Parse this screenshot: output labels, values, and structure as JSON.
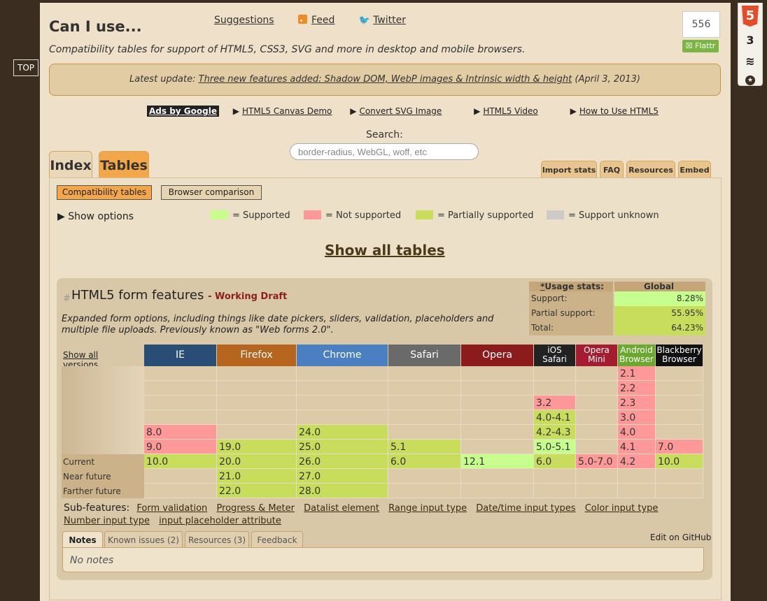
{
  "top_button": "TOP",
  "header": {
    "title": "Can I use...",
    "tagline": "Compatibility tables for support of HTML5, CSS3, SVG and more in desktop and mobile browsers.",
    "links": {
      "suggestions": "Suggestions",
      "feed": "Feed",
      "twitter": "Twitter"
    },
    "flattr_count": "556",
    "flattr_label": "Flattr"
  },
  "update": {
    "prefix": "Latest update:",
    "link": "Three new features added: Shadow DOM, WebP images & Intrinsic width & height",
    "date": "(April 3, 2013)"
  },
  "ads": {
    "label": "Ads by Google",
    "links": [
      "HTML5 Canvas Demo",
      "Convert SVG Image",
      "HTML5 Video",
      "How to Use HTML5"
    ]
  },
  "search": {
    "label": "Search:",
    "placeholder": "border-radius, WebGL, woff, etc"
  },
  "tabs": {
    "main": [
      "Index",
      "Tables"
    ],
    "active": "Tables",
    "small": [
      "Import stats",
      "FAQ",
      "Resources",
      "Embed"
    ]
  },
  "panel": {
    "modes": [
      "Compatibility tables",
      "Browser comparison"
    ],
    "show_options": "Show options",
    "legend": [
      {
        "label": "= Supported",
        "color": "#c6ff8e"
      },
      {
        "label": "= Not supported",
        "color": "#ff9999"
      },
      {
        "label": "= Partially supported",
        "color": "#c8dd5c"
      },
      {
        "label": "= Support unknown",
        "color": "#cfcaca"
      }
    ],
    "show_all_tables": "Show all tables"
  },
  "feature": {
    "hash": "#",
    "title": "HTML5 form features",
    "status_sep": "-",
    "status": "Working Draft",
    "description": "Expanded form options, including things like date pickers, sliders, validation, placeholders and multiple file uploads. Previously known as \"Web forms 2.0\".",
    "usage": {
      "header_label": "Usage stats:",
      "header_star": "*",
      "header_value": "Global",
      "rows": [
        {
          "label": "Support:",
          "value": "8.28%",
          "color": "#c6ff8e"
        },
        {
          "label": "Partial support:",
          "value": "55.95%",
          "color": "#c8dd5c"
        },
        {
          "label": "Total:",
          "value": "64.23%",
          "color": "#c8dd5c"
        }
      ]
    },
    "show_all_versions": "Show all versions",
    "row_labels": [
      "",
      "",
      "",
      "",
      "",
      "",
      "Current",
      "Near future",
      "Farther future"
    ],
    "browsers": [
      {
        "name": "IE",
        "color": "#294d75",
        "cells": [
          null,
          null,
          null,
          null,
          [
            "8.0",
            "n"
          ],
          [
            "9.0",
            "n"
          ],
          [
            "10.0",
            "p"
          ],
          null,
          null
        ]
      },
      {
        "name": "Firefox",
        "color": "#b5651d",
        "cells": [
          null,
          null,
          null,
          null,
          null,
          [
            "19.0",
            "p"
          ],
          [
            "20.0",
            "p"
          ],
          [
            "21.0",
            "p"
          ],
          [
            "22.0",
            "p"
          ]
        ]
      },
      {
        "name": "Chrome",
        "color": "#4a7fc1",
        "cells": [
          null,
          null,
          null,
          null,
          [
            "24.0",
            "p"
          ],
          [
            "25.0",
            "p"
          ],
          [
            "26.0",
            "p"
          ],
          [
            "27.0",
            "p"
          ],
          [
            "28.0",
            "p"
          ]
        ]
      },
      {
        "name": "Safari",
        "color": "#6a6a6a",
        "cells": [
          null,
          null,
          null,
          null,
          null,
          [
            "5.1",
            "p"
          ],
          [
            "6.0",
            "p"
          ],
          null,
          null
        ]
      },
      {
        "name": "Opera",
        "color": "#8c1c1c",
        "cells": [
          null,
          null,
          null,
          null,
          null,
          null,
          [
            "12.1",
            "y"
          ],
          null,
          null
        ]
      },
      {
        "name": "iOS Safari",
        "color": "#222222",
        "cells": [
          null,
          null,
          [
            "3.2",
            "n"
          ],
          [
            "4.0-4.1",
            "p"
          ],
          [
            "4.2-4.3",
            "p"
          ],
          [
            "5.0-5.1",
            "y"
          ],
          [
            "6.0",
            "p"
          ],
          null,
          null
        ]
      },
      {
        "name": "Opera Mini",
        "color": "#a51c30",
        "cells": [
          null,
          null,
          null,
          null,
          null,
          null,
          [
            "5.0-7.0",
            "n"
          ],
          null,
          null
        ]
      },
      {
        "name": "Android Browser",
        "color": "#6aa82e",
        "cells": [
          [
            "2.1",
            "n"
          ],
          [
            "2.2",
            "n"
          ],
          [
            "2.3",
            "n"
          ],
          [
            "3.0",
            "n"
          ],
          [
            "4.0",
            "n"
          ],
          [
            "4.1",
            "n"
          ],
          [
            "4.2",
            "n"
          ],
          null,
          null
        ]
      },
      {
        "name": "Blackberry Browser",
        "color": "#111111",
        "cells": [
          null,
          null,
          null,
          null,
          null,
          [
            "7.0",
            "n"
          ],
          [
            "10.0",
            "p"
          ],
          null,
          null
        ]
      }
    ],
    "status_colors": {
      "y": "#c6ff8e",
      "n": "#ff9999",
      "p": "#c8dd5c",
      "u": "#cfcaca"
    },
    "subfeatures": {
      "label": "Sub-features:",
      "links": [
        "Form validation",
        "Progress & Meter",
        "Datalist element",
        "Range input type",
        "Date/time input types",
        "Color input type",
        "Number input type",
        "input placeholder attribute"
      ]
    },
    "note_tabs": [
      "Notes",
      "Known issues (2)",
      "Resources (3)",
      "Feedback"
    ],
    "edit_github": "Edit on GitHub",
    "notes_text": "No notes"
  }
}
